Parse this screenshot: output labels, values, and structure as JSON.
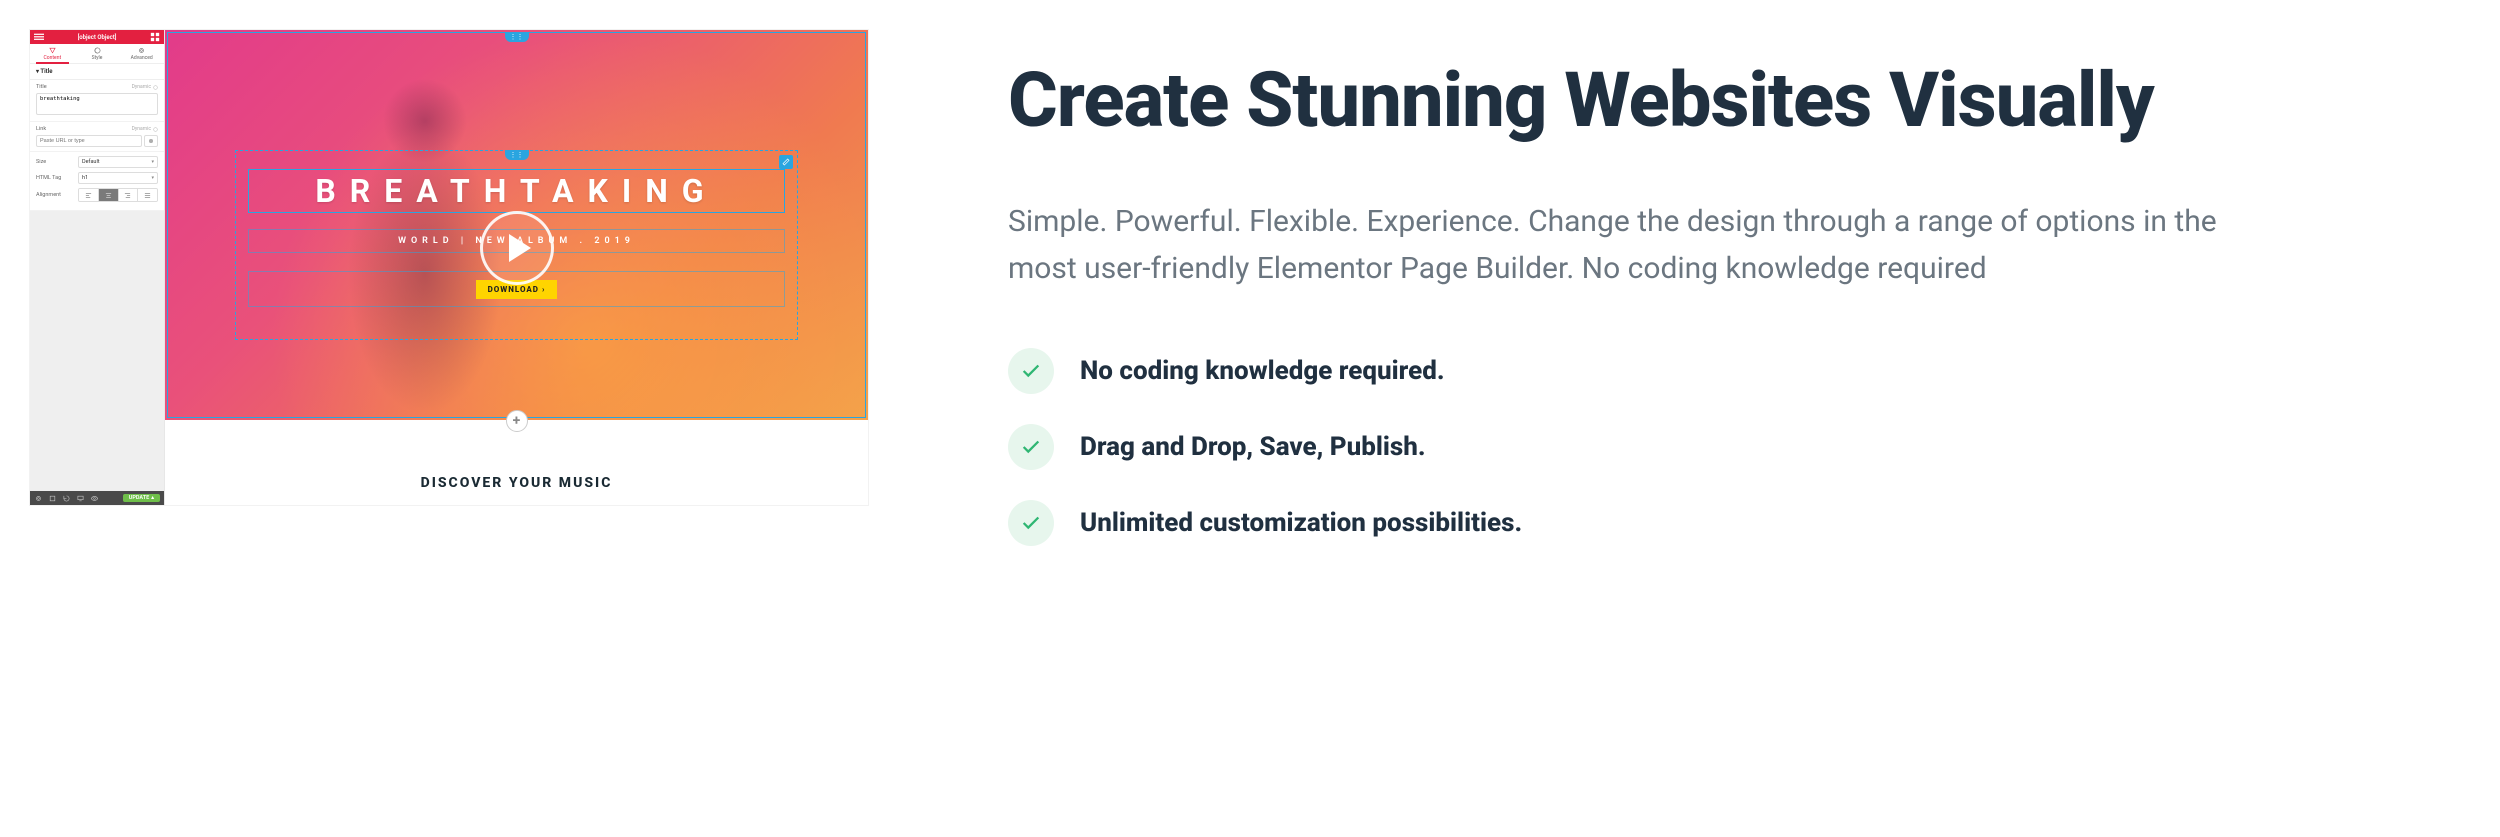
{
  "panel": {
    "title": {
      "label": "Title",
      "dynamic": "Dynamic",
      "value": "breathtaking"
    },
    "tabs": {
      "content": "Content",
      "style": "Style",
      "advanced": "Advanced"
    },
    "accordion": {
      "section": "Title",
      "caret": "▲"
    },
    "link": {
      "label": "Link",
      "dynamic": "Dynamic",
      "placeholder": "Paste URL or type"
    },
    "size": {
      "label": "Size",
      "value": "Default"
    },
    "htmltag": {
      "label": "HTML Tag",
      "value": "h1"
    },
    "alignment": {
      "label": "Alignment"
    },
    "footer": {
      "update": "UPDATE"
    }
  },
  "hero": {
    "heading": "BREATHTAKING",
    "subtitle": "WORLD | NEW ALBUM . 2019",
    "download": "DOWNLOAD",
    "discover": "DISCOVER YOUR MUSIC"
  },
  "right": {
    "headline": "Create Stunning Websites Visually",
    "paragraph": "Simple. Powerful. Flexible. Experience. Change the design through a range of options in the most user-friendly Elementor Page Builder. No coding knowledge required",
    "features": [
      "No coding knowledge required.",
      "Drag and Drop, Save, Publish.",
      "Unlimited customization possibilities."
    ]
  }
}
